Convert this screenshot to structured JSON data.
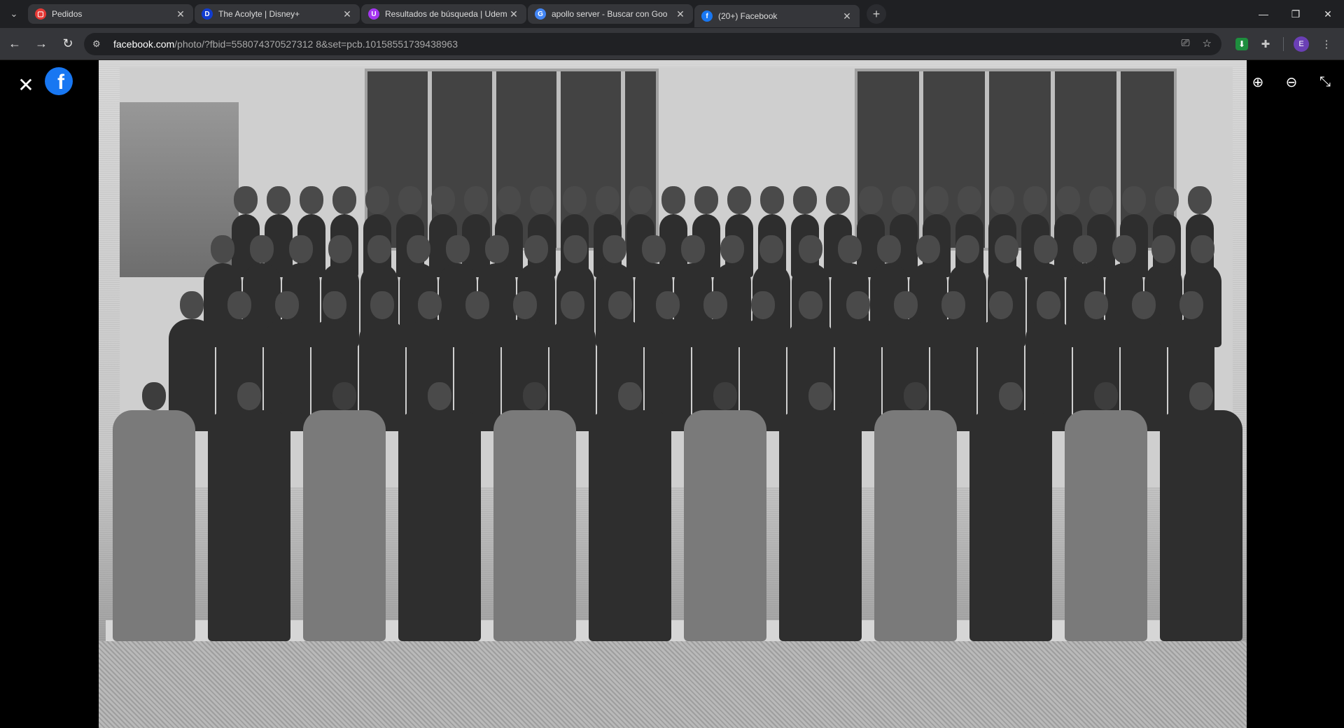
{
  "browser": {
    "tabs": [
      {
        "label": "Pedidos",
        "favicon": "pedidos-favicon",
        "color": "#e53935",
        "glyph": "▢",
        "active": false
      },
      {
        "label": "The Acolyte | Disney+",
        "favicon": "disney-favicon",
        "color": "#113ccf",
        "glyph": "D",
        "active": false
      },
      {
        "label": "Resultados de búsqueda | Udem",
        "favicon": "udemy-favicon",
        "color": "#a435f0",
        "glyph": "U",
        "active": false
      },
      {
        "label": "apollo server - Buscar con Goo",
        "favicon": "google-favicon",
        "color": "#4285f4",
        "glyph": "G",
        "active": false
      },
      {
        "label": "(20+) Facebook",
        "favicon": "facebook-favicon",
        "color": "#1877f2",
        "glyph": "f",
        "active": true
      }
    ],
    "url_domain": "facebook.com",
    "url_path": "/photo/?fbid=558074370527312 8&set=pcb.10158551739438963",
    "avatar_letter": "E"
  },
  "viewer": {
    "logo_glyph": "f",
    "close_glyph": "✕",
    "zoom_in_glyph": "⊕",
    "zoom_out_glyph": "⊖",
    "exit_fullscreen_glyph": "⤡"
  },
  "photo": {
    "description_visible": false
  }
}
